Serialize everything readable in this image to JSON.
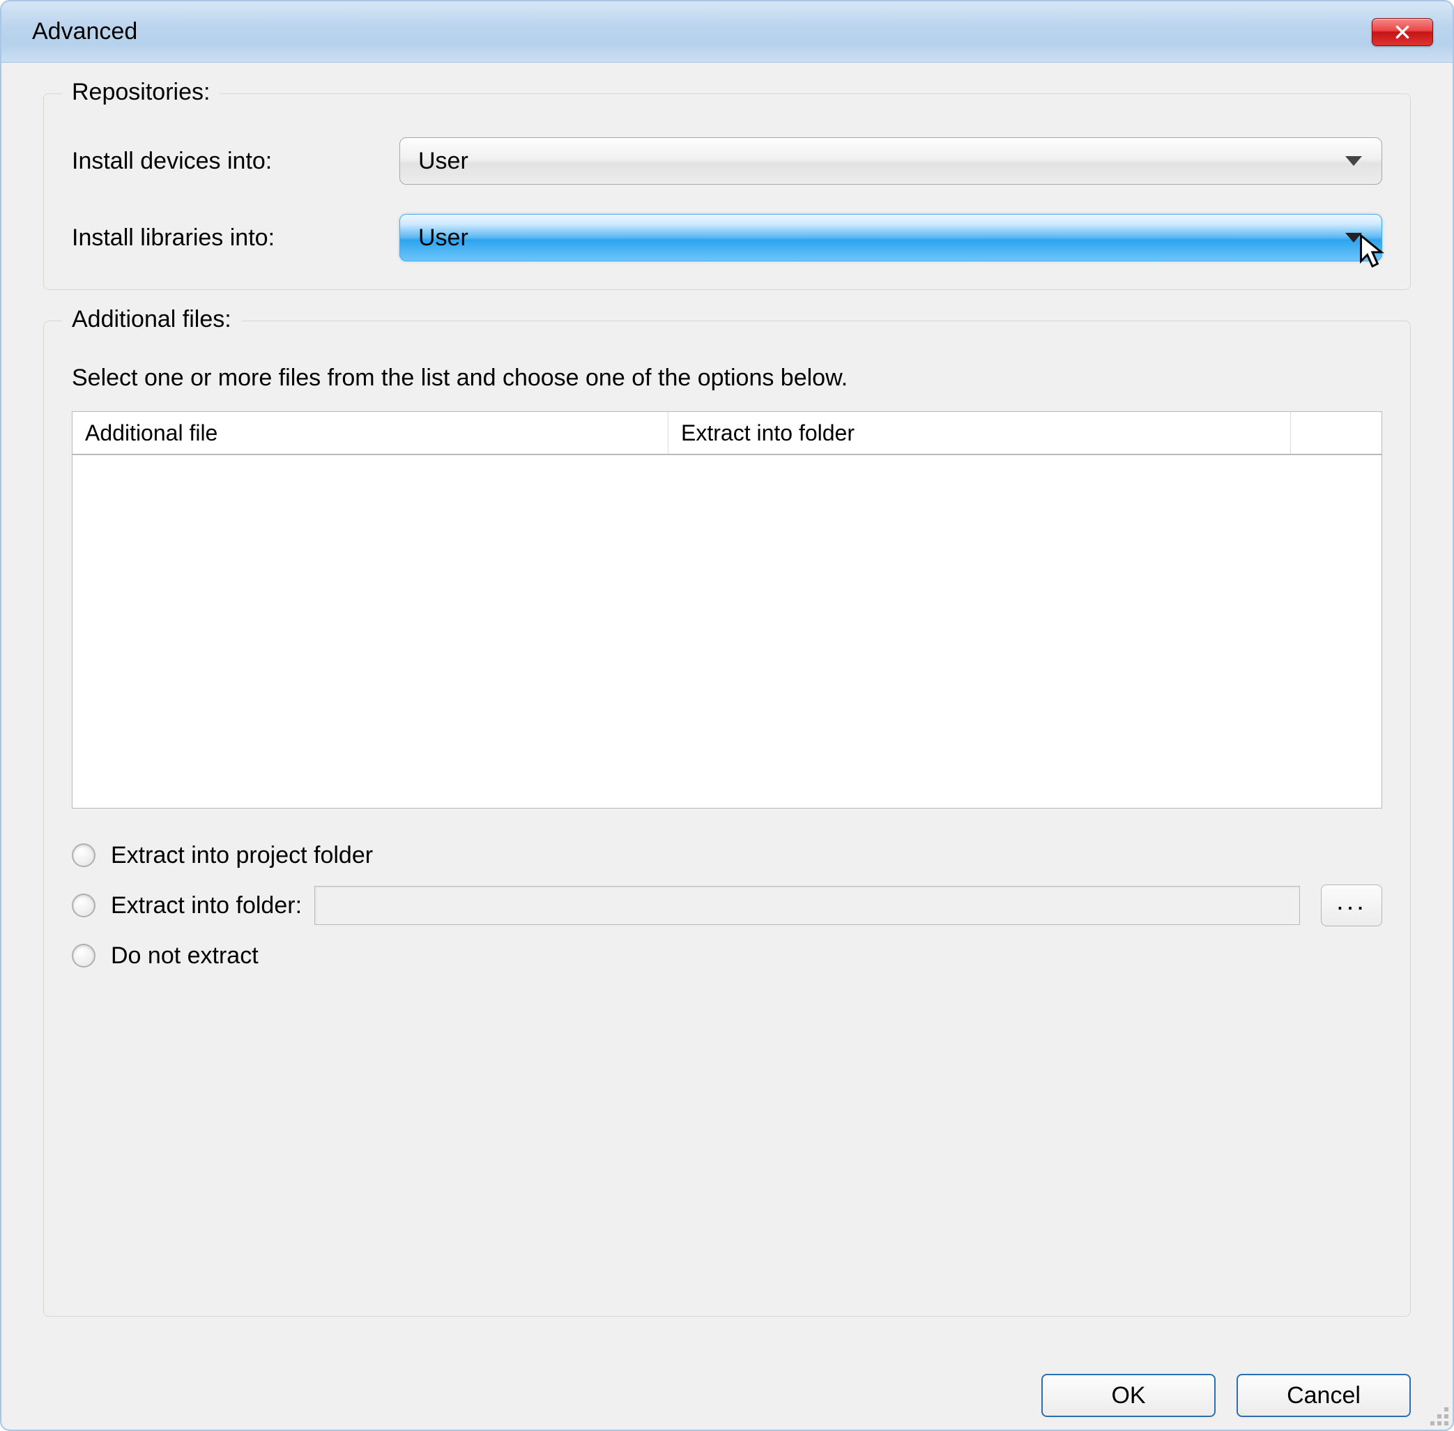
{
  "window": {
    "title": "Advanced"
  },
  "repositories": {
    "legend": "Repositories:",
    "devices_label": "Install devices into:",
    "devices_value": "User",
    "libraries_label": "Install libraries into:",
    "libraries_value": "User"
  },
  "additional": {
    "legend": "Additional files:",
    "instruction": "Select one or more files from the list and choose one of the options below.",
    "columns": {
      "file": "Additional file",
      "folder": "Extract into folder"
    },
    "rows": [],
    "options": {
      "extract_project": "Extract into project folder",
      "extract_folder": "Extract into folder:",
      "do_not_extract": "Do not extract",
      "folder_path": "",
      "browse_label": "..."
    }
  },
  "buttons": {
    "ok": "OK",
    "cancel": "Cancel"
  }
}
